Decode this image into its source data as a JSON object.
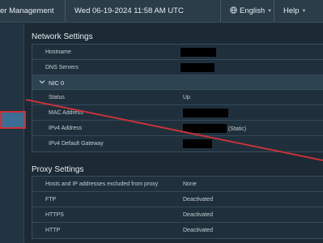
{
  "header": {
    "app_title": "er Management",
    "datetime": "Wed 06-19-2024 11:58 AM UTC",
    "language": "English",
    "help": "Help"
  },
  "network": {
    "title": "Network Settings",
    "hostname_label": "Hostname",
    "dns_label": "DNS Servers",
    "nic_name": "NIC 0",
    "status_label": "Status",
    "status_value": "Up",
    "mac_label": "MAC Address",
    "ipv4_label": "IPv4 Address",
    "ipv4_suffix": "(Static)",
    "gateway_label": "IPv4 Default Gateway"
  },
  "proxy": {
    "title": "Proxy Settings",
    "rows": [
      {
        "label": "Hosts and IP addresses excluded from proxy",
        "value": "None"
      },
      {
        "label": "FTP",
        "value": "Deactivated"
      },
      {
        "label": "HTTPS",
        "value": "Deactivated"
      },
      {
        "label": "HTTP",
        "value": "Deactivated"
      }
    ]
  },
  "icons": {
    "language": "globe-icon",
    "nic_toggle": "chevron-down-icon"
  },
  "colors": {
    "background": "#1b2a35",
    "topbar": "#2c3d4a",
    "selected_nav": "#3b6f93",
    "annotation": "#c8323a"
  }
}
